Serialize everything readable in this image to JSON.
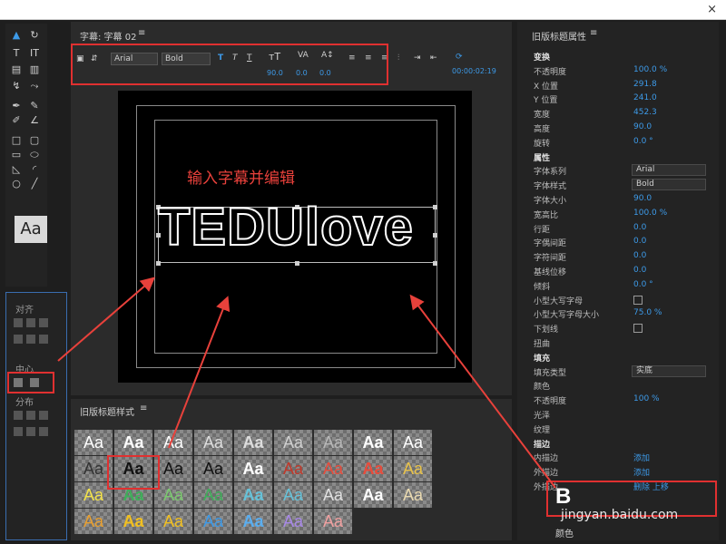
{
  "window": {
    "close_glyph": "×"
  },
  "title_panel": {
    "header": "字幕: 字幕 02",
    "font_family": "Arial",
    "font_style": "Bold",
    "font_size": "90.0",
    "kerning": "0.0",
    "baseline": "0.0",
    "timecode": "00:00:02:19",
    "canvas_text": "TEDUlove"
  },
  "annotation": "输入字幕并编辑",
  "styles_panel": {
    "header": "旧版标题样式",
    "swatch_label": "Aa"
  },
  "align_panel": {
    "align_label": "对齐",
    "center_label": "中心",
    "distribute_label": "分布"
  },
  "properties": {
    "header": "旧版标题属性",
    "rows": [
      {
        "label": "变换",
        "section": true
      },
      {
        "label": "不透明度",
        "value": "100.0 %"
      },
      {
        "label": "X 位置",
        "value": "291.8"
      },
      {
        "label": "Y 位置",
        "value": "241.0"
      },
      {
        "label": "宽度",
        "value": "452.3"
      },
      {
        "label": "高度",
        "value": "90.0"
      },
      {
        "label": "旋转",
        "value": "0.0 °"
      },
      {
        "label": "属性",
        "section": true
      },
      {
        "label": "字体系列",
        "select": "Arial"
      },
      {
        "label": "字体样式",
        "select": "Bold"
      },
      {
        "label": "字体大小",
        "value": "90.0"
      },
      {
        "label": "宽高比",
        "value": "100.0 %"
      },
      {
        "label": "行距",
        "value": "0.0"
      },
      {
        "label": "字偶间距",
        "value": "0.0"
      },
      {
        "label": "字符间距",
        "value": "0.0"
      },
      {
        "label": "基线位移",
        "value": "0.0"
      },
      {
        "label": "倾斜",
        "value": "0.0 °"
      },
      {
        "label": "小型大写字母",
        "check": true
      },
      {
        "label": "小型大写字母大小",
        "value": "75.0 %"
      },
      {
        "label": "下划线",
        "check": true
      },
      {
        "label": "扭曲"
      },
      {
        "label": "填充",
        "section": true
      },
      {
        "label": "填充类型",
        "select": "实底"
      },
      {
        "label": "颜色"
      },
      {
        "label": "不透明度",
        "value": "100 %"
      },
      {
        "label": "光泽"
      },
      {
        "label": "纹理"
      },
      {
        "label": "描边",
        "section": true
      },
      {
        "label": "内描边",
        "value": "添加"
      },
      {
        "label": "外描边",
        "value": "添加"
      },
      {
        "label": "外描边",
        "value": "删除   上移"
      }
    ],
    "bottom_label": "颜色"
  },
  "watermark": "jingyan.baidu.com",
  "watermark_glyph": "B"
}
